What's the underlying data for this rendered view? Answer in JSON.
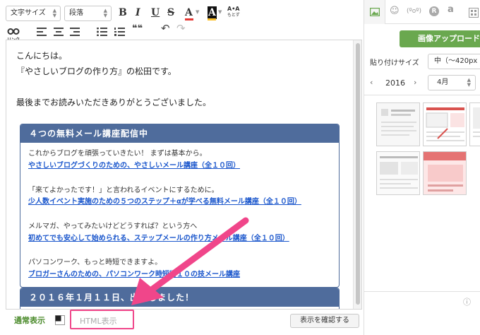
{
  "toolbar": {
    "font_size": "文字サイズ",
    "paragraph": "段落",
    "bold": "B",
    "italic": "I",
    "underline": "U",
    "strike": "S",
    "text_color": "A",
    "bg_color": "A",
    "ruby_top": "A•A",
    "ruby_bottom": "もとず",
    "link_label": "リンク",
    "quote": "❝❝",
    "undo": "↶",
    "redo": "↷"
  },
  "editor": {
    "line1": "こんにちは。",
    "line2": "『やさしいブログの作り方』の松田です。",
    "line3": "最後までお読みいただきありがとうございました。",
    "box1": {
      "header": "４つの無料メール講座配信中",
      "items": [
        {
          "text": "これからブログを頑張っていきたい！ まずは基本から。",
          "link": "やさしいブログづくりのための、やさしいメール講座（全１０回）"
        },
        {
          "text": "「来てよかったです！」と言われるイベントにするために。",
          "link": "少人数イベント実施のための５つのステップ＋αが学べる無料メール講座（全１０回）"
        },
        {
          "text": "メルマガ、やってみたいけどどうすれば？という方へ",
          "link": "初めてでも安心して始められる、ステップメールの作り方メール講座（全１０回）"
        },
        {
          "text": "パソコンワーク、もっと時短できますよ。",
          "link": "ブロガーさんのための、パソコンワーク時短術１０の技メール講座"
        }
      ]
    },
    "box2": {
      "header": "２０１６年１月１１日、出版しました！"
    }
  },
  "bottom": {
    "normal_view": "通常表示",
    "html_view": "HTML表示",
    "confirm_button": "表示を確認する"
  },
  "right_panel": {
    "tab_text_face": "(ºoº)",
    "tab_r": "R",
    "tab_amazon": "a",
    "upload_button": "画像アップロード",
    "paste_size_label": "貼り付けサイズ",
    "paste_size_value": "中（〜420px",
    "year": "2016",
    "month": "4月",
    "info_icon": "ⓘ"
  },
  "colors": {
    "box_header": "#4f6c9c",
    "link": "#1a56cc",
    "upload_button": "#6aa84f",
    "arrow": "#f0468a",
    "normal_view": "#4a8a2a"
  }
}
